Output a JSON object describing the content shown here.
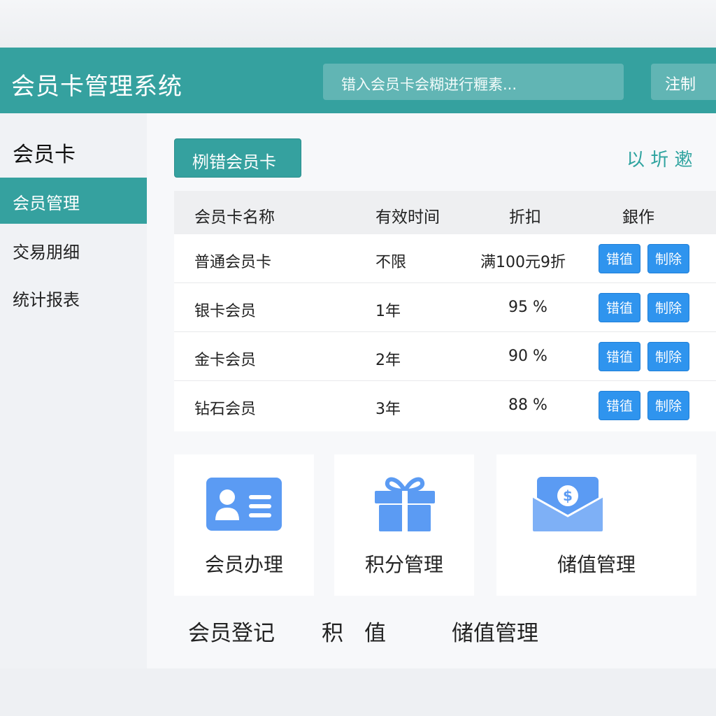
{
  "header": {
    "title": "会员卡管理系统",
    "search_placeholder": "错入会员卡会糊进行糎素...",
    "login_label": "注制"
  },
  "sidebar": {
    "title": "会员卡",
    "items": [
      {
        "label": "会员管理",
        "active": true
      },
      {
        "label": "交易朋细",
        "active": false
      },
      {
        "label": "统计报表",
        "active": false
      }
    ]
  },
  "toolbar": {
    "add_label": "栵错会员卡",
    "right_link": "以 圻  遬"
  },
  "table": {
    "headers": [
      "会员卡名称",
      "有效时间",
      "折扣",
      "銀作"
    ],
    "rows": [
      {
        "name": "普通会员卡",
        "validity": "不限",
        "discount": "满100元9折",
        "edit": "错徝",
        "delete": "制除"
      },
      {
        "name": "银卡会员",
        "validity": "1年",
        "discount": "95 %",
        "edit": "错徝",
        "delete": "制除"
      },
      {
        "name": "金卡会员",
        "validity": "2年",
        "discount": "90 %",
        "edit": "错徝",
        "delete": "制除"
      },
      {
        "name": "钻石会员",
        "validity": "3年",
        "discount": "88 %",
        "edit": "错徝",
        "delete": "制除"
      }
    ]
  },
  "cards": [
    {
      "label": "会员办理",
      "icon": "id-card-icon"
    },
    {
      "label": "积分管理",
      "icon": "gift-icon"
    },
    {
      "label": "储值管理",
      "icon": "money-envelope-icon"
    }
  ],
  "bottom_labels": [
    "会员登记",
    "积",
    "值",
    "储值管理"
  ],
  "colors": {
    "primary": "#35a19f",
    "button_blue": "#2f94ee",
    "icon_blue": "#5b9bf3"
  }
}
